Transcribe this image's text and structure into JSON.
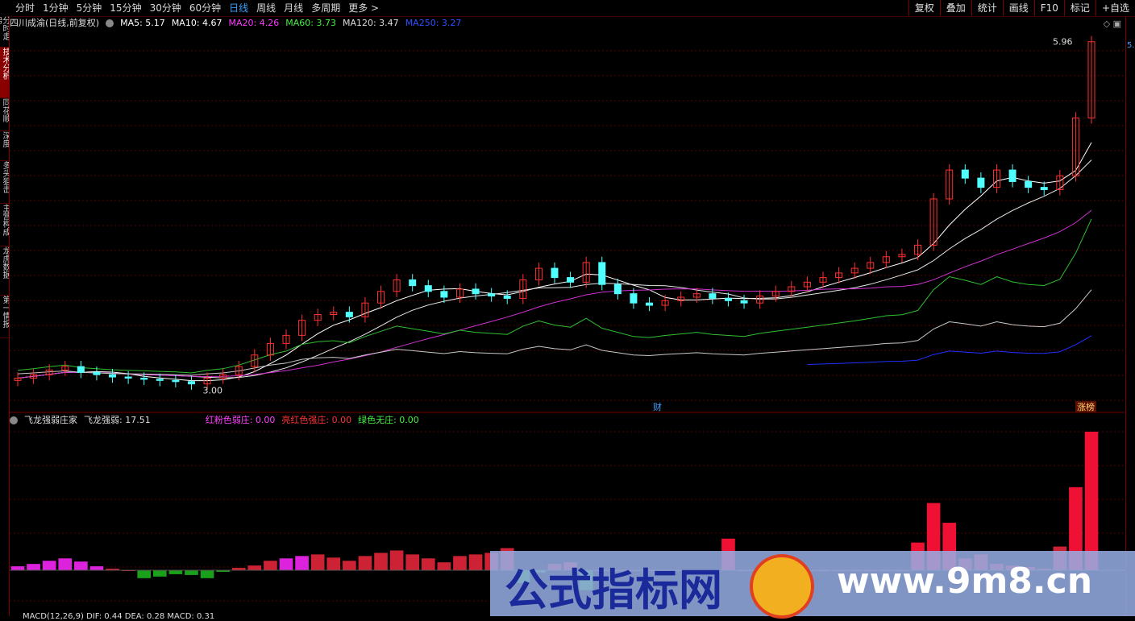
{
  "toolbar": {
    "left_items": [
      "分时",
      "1分钟",
      "5分钟",
      "15分钟",
      "30分钟",
      "60分钟",
      "日线",
      "周线",
      "月线",
      "多周期",
      "更多 >"
    ],
    "active_index": 6,
    "right_items": [
      "复权",
      "叠加",
      "统计",
      "画线",
      "F10",
      "标记",
      "+自选"
    ]
  },
  "sidebar": {
    "tabs": [
      "分时走势",
      "技术分析",
      "同花顺",
      "深度F9",
      "多头狙击",
      "主营构成",
      "龙虎数据",
      "第一情报"
    ],
    "active_index": 1
  },
  "main": {
    "title": "四川成渝(日线,前复权)",
    "ma": [
      {
        "label": "MA5: 5.17",
        "color": "#ffffff"
      },
      {
        "label": "MA10: 4.67",
        "color": "#ffffff"
      },
      {
        "label": "MA20: 4.26",
        "color": "#ff3aff"
      },
      {
        "label": "MA60: 3.73",
        "color": "#44ee44"
      },
      {
        "label": "MA120: 3.47",
        "color": "#dddddd"
      },
      {
        "label": "MA250: 3.27",
        "color": "#3050ff"
      }
    ],
    "high_label": "5.96",
    "low_label": "3.00",
    "axis_right_label": "5.",
    "marker_cai": "财",
    "marker_zhangbang": "涨榜"
  },
  "sub": {
    "title": "飞龙强弱庄家",
    "value_label": "飞龙强弱: 17.51",
    "items": [
      {
        "label": "红粉色弱庄: 0.00",
        "color": "#ff44ff"
      },
      {
        "label": "亮红色强庄: 0.00",
        "color": "#ff3333"
      },
      {
        "label": "绿色无庄: 0.00",
        "color": "#44ee44"
      }
    ]
  },
  "bottom_legend": "MACD(12,26,9)  DIF: 0.44  DEA: 0.28  MACD: 0.31",
  "watermark": {
    "left_text": "公式指标网",
    "right_text": "www.9m8.cn"
  },
  "chart_data": {
    "type": "candlestick",
    "title": "四川成渝(日线,前复权)",
    "high": 5.96,
    "low": 3.0,
    "closes": [
      3.05,
      3.08,
      3.12,
      3.15,
      3.1,
      3.08,
      3.06,
      3.05,
      3.04,
      3.03,
      3.02,
      3.0,
      3.05,
      3.08,
      3.15,
      3.25,
      3.35,
      3.42,
      3.55,
      3.6,
      3.62,
      3.58,
      3.7,
      3.8,
      3.9,
      3.85,
      3.8,
      3.75,
      3.82,
      3.78,
      3.76,
      3.74,
      3.9,
      4.0,
      3.92,
      3.88,
      4.05,
      3.86,
      3.78,
      3.7,
      3.68,
      3.72,
      3.75,
      3.78,
      3.74,
      3.72,
      3.7,
      3.76,
      3.8,
      3.84,
      3.88,
      3.92,
      3.96,
      4.0,
      4.05,
      4.1,
      4.12,
      4.2,
      4.6,
      4.85,
      4.78,
      4.7,
      4.85,
      4.75,
      4.7,
      4.68,
      4.8,
      5.3,
      5.96
    ],
    "sub_values": [
      0.5,
      0.8,
      1.2,
      1.5,
      1.1,
      0.5,
      0.2,
      0,
      -1.0,
      -0.8,
      -0.5,
      -0.6,
      -1.0,
      -0.2,
      0.3,
      0.6,
      1.2,
      1.5,
      1.8,
      2.0,
      1.6,
      1.2,
      1.8,
      2.2,
      2.5,
      2.0,
      1.5,
      1.0,
      1.8,
      2.0,
      2.2,
      2.8,
      -1.6,
      -0.3,
      0.8,
      1.0,
      -2.5,
      0,
      0,
      0,
      0,
      0,
      0,
      0,
      0,
      4.0,
      0,
      0,
      0,
      0,
      0,
      0,
      0,
      0,
      0,
      0,
      0,
      3.5,
      8.5,
      6.0,
      1.5,
      2.0,
      0.8,
      0.6,
      0.4,
      0.2,
      3.0,
      10.5,
      17.51
    ]
  }
}
